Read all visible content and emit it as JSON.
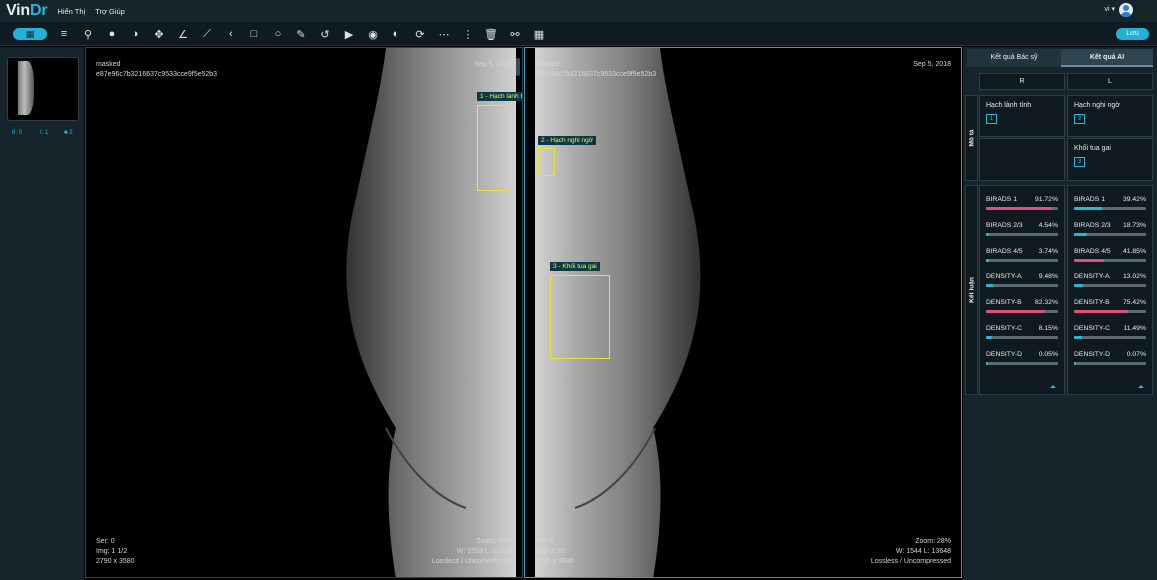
{
  "app": {
    "logo_primary": "Vin",
    "logo_accent": "Dr",
    "menu": [
      "Hiển Thị",
      "Trợ Giúp"
    ],
    "language": "vi ▾"
  },
  "toolbar": {
    "icons": [
      "list-icon",
      "search-icon",
      "circle-filled-icon",
      "contrast-icon",
      "move-icon",
      "angle-measure-icon",
      "ruler-icon",
      "chevron-left-icon",
      "rectangle-icon",
      "ellipse-icon",
      "freehand-icon",
      "undo-icon",
      "cine-icon",
      "target-icon",
      "invert-icon",
      "reset-icon",
      "more-horizontal-icon",
      "more-vertical-icon",
      "trash-icon",
      "link-icon",
      "grid-icon"
    ],
    "report_label": "Lưu"
  },
  "thumbnails": {
    "stat1": "8: 0",
    "stat2": "I: 1",
    "stat3": "2"
  },
  "viewports": [
    {
      "patient": "masked",
      "study_id": "e87e96c7b3216637c9533cce9f5e52b3",
      "date": "Sep 5, 2018",
      "series": "Ser: 0",
      "image": "Img: 1 1/2",
      "size": "2790 x 3580",
      "zoom": "Zoom: 28%",
      "window": "W: 1593 L: 13418",
      "compression": "Lossless / Uncompressed",
      "findings": [
        {
          "label": "1 - Hạch lành tính"
        }
      ]
    },
    {
      "patient": "masked",
      "study_id": "e87e96c7b3216637c9533cce9f5e52b3",
      "date": "Sep 5, 2018",
      "series": "Ser: 0",
      "image": "Img: 2 2/2",
      "size": "2790 x 3580",
      "zoom": "Zoom: 28%",
      "window": "W: 1544 L: 13648",
      "compression": "Lossless / Uncompressed",
      "findings": [
        {
          "label": "2 - Hạch nghi ngờ"
        },
        {
          "label": "3 - Khối tua gai"
        }
      ]
    }
  ],
  "result_panel": {
    "tabs": [
      "Kết quả Bác sỹ",
      "Kết quả AI"
    ],
    "sides": [
      "R",
      "L"
    ],
    "section_desc": "Mô tả",
    "section_conclusion": "Kết luận",
    "desc_R": [
      {
        "name": "Hạch lành tính",
        "num": "1"
      }
    ],
    "desc_L": [
      {
        "name": "Hạch nghi ngờ",
        "num": "2"
      },
      {
        "name": "Khối tua gai",
        "num": "3"
      }
    ],
    "metrics_R": [
      {
        "label": "BIRADS 1",
        "value": "91.72%",
        "fraction": 0.9172,
        "color": "#e0507a"
      },
      {
        "label": "BIRADS 2/3",
        "value": "4.54%",
        "fraction": 0.0454,
        "color": "#29b6d8"
      },
      {
        "label": "BIRADS 4/5",
        "value": "3.74%",
        "fraction": 0.0374,
        "color": "#29b6d8"
      },
      {
        "label": "DENSITY-A",
        "value": "9.48%",
        "fraction": 0.0948,
        "color": "#29b6d8"
      },
      {
        "label": "DENSITY-B",
        "value": "82.32%",
        "fraction": 0.8232,
        "color": "#e0507a"
      },
      {
        "label": "DENSITY-C",
        "value": "8.15%",
        "fraction": 0.0815,
        "color": "#29b6d8"
      },
      {
        "label": "DENSITY-D",
        "value": "0.05%",
        "fraction": 0.0005,
        "color": "#29b6d8"
      }
    ],
    "metrics_L": [
      {
        "label": "BIRADS 1",
        "value": "39.42%",
        "fraction": 0.3942,
        "color": "#29b6d8"
      },
      {
        "label": "BIRADS 2/3",
        "value": "18.73%",
        "fraction": 0.1873,
        "color": "#29b6d8"
      },
      {
        "label": "BIRADS 4/5",
        "value": "41.85%",
        "fraction": 0.4185,
        "color": "#e0507a"
      },
      {
        "label": "DENSITY-A",
        "value": "13.02%",
        "fraction": 0.1302,
        "color": "#29b6d8"
      },
      {
        "label": "DENSITY-B",
        "value": "75.42%",
        "fraction": 0.7542,
        "color": "#e0507a"
      },
      {
        "label": "DENSITY-C",
        "value": "11.49%",
        "fraction": 0.1149,
        "color": "#29b6d8"
      },
      {
        "label": "DENSITY-D",
        "value": "0.07%",
        "fraction": 0.0007,
        "color": "#29b6d8"
      }
    ]
  }
}
